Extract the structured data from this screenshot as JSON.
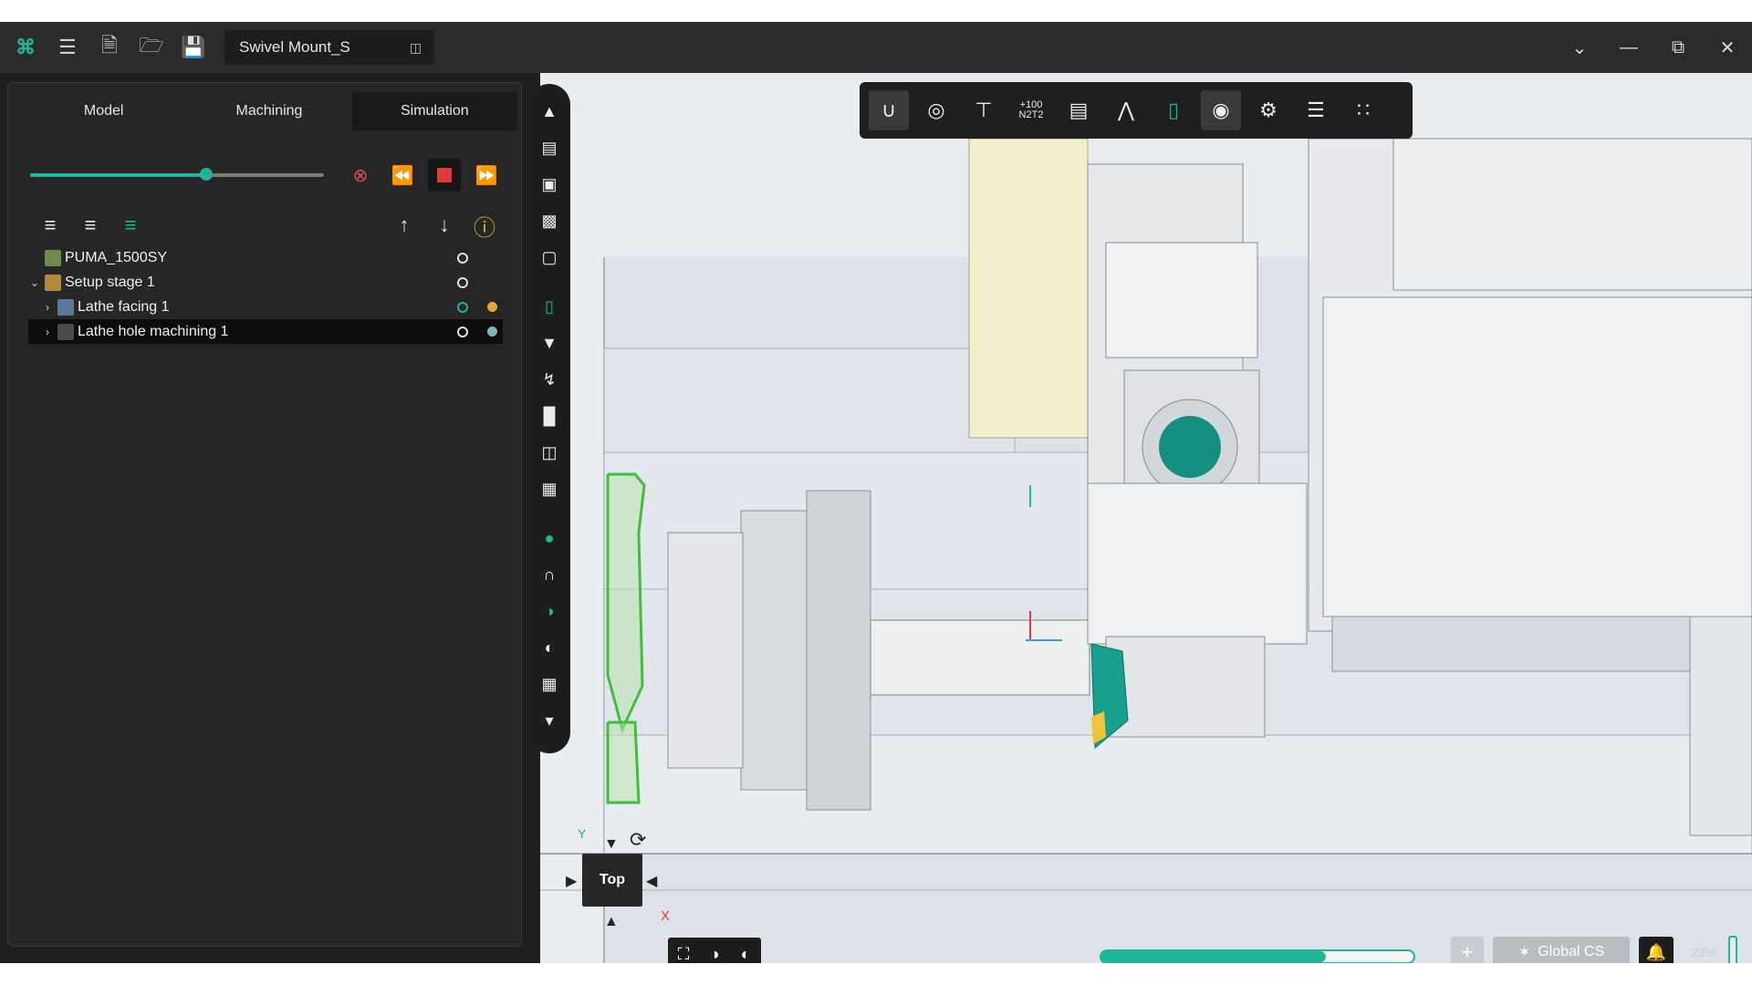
{
  "titlebar": {
    "document_name": "Swivel Mount_S"
  },
  "tabs": [
    {
      "label": "Model"
    },
    {
      "label": "Machining"
    },
    {
      "label": "Simulation"
    }
  ],
  "simulation": {
    "progress": 0.6
  },
  "tree": {
    "machine": "PUMA_1500SY",
    "setup": "Setup stage 1",
    "operations": [
      {
        "label": "Lathe facing 1",
        "status_color": "#e8a534"
      },
      {
        "label": "Lathe hole machining 1",
        "status_color": "#7fb6b6"
      }
    ]
  },
  "toolbar_top": {
    "n2t2_label": "N2T2",
    "n2t2_value": "+100"
  },
  "viewcube": {
    "face": "Top",
    "axis_y": "Y",
    "axis_x": "X"
  },
  "statusbar": {
    "coordinate_system": "Global CS",
    "progress": 0.72,
    "zoom": "23%"
  },
  "colors": {
    "accent": "#1fb59a",
    "stop": "#e03a3a",
    "panel": "#262626"
  }
}
